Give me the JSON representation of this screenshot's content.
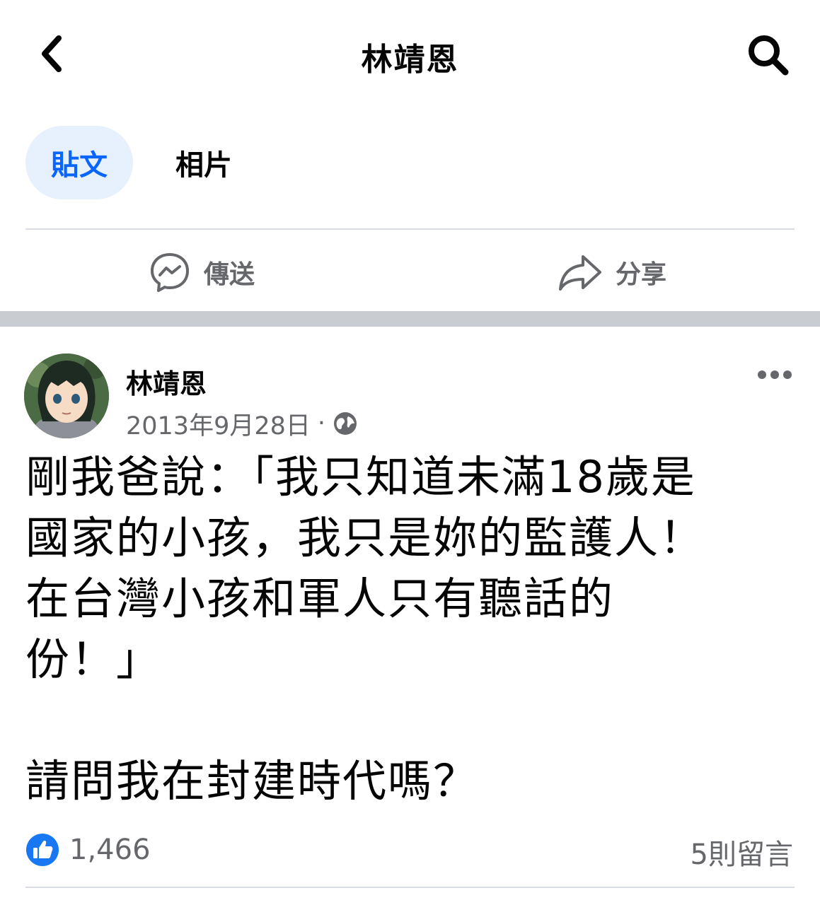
{
  "header": {
    "title": "林靖恩",
    "back_icon": "chevron-left-icon",
    "search_icon": "search-icon"
  },
  "tabs": [
    {
      "label": "貼文",
      "active": true
    },
    {
      "label": "相片",
      "active": false
    }
  ],
  "actions": {
    "send_label": "傳送",
    "send_icon": "messenger-icon",
    "share_label": "分享",
    "share_icon": "share-arrow-icon"
  },
  "post": {
    "author": "林靖恩",
    "date": "2013年9月28日",
    "separator": "·",
    "privacy_icon": "globe-icon",
    "text_lines": [
      "剛我爸說：「我只知道未滿18歲是",
      "國家的小孩，我只是妳的監護人！",
      "在台灣小孩和軍人只有聽話的",
      "份！」"
    ],
    "question": "請問我在封建時代嗎？",
    "like_count": "1,466",
    "comments": "5則留言"
  },
  "colors": {
    "accent": "#0866ff",
    "tab_active_bg": "#e7f0fd",
    "secondary_text": "#65676b",
    "divider": "#dadde1",
    "band": "#c9ccd1"
  }
}
